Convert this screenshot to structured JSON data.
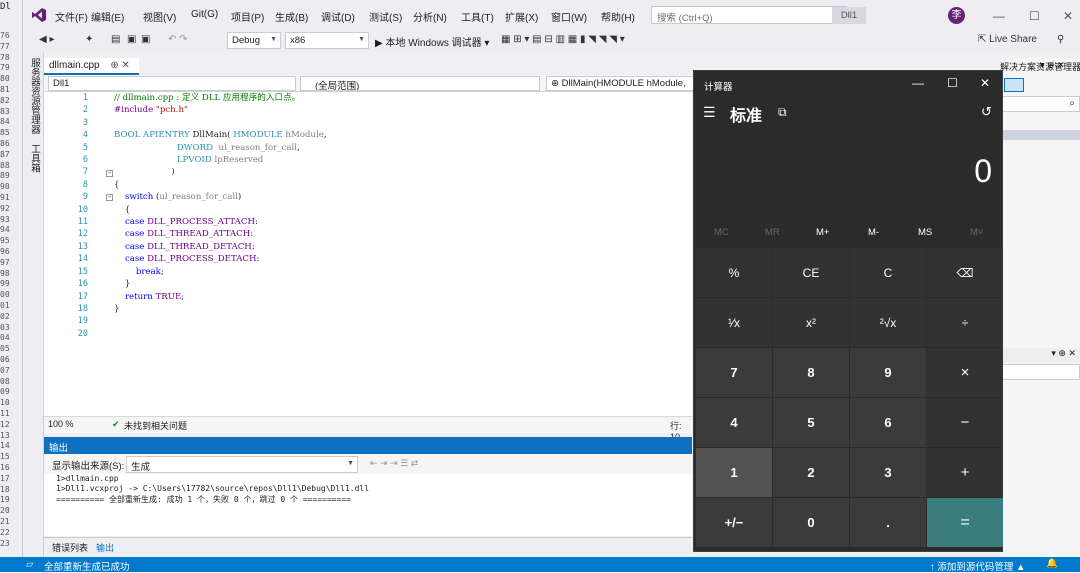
{
  "window_title_prefix": "Dl",
  "menu": [
    "文件(F)",
    "编辑(E)",
    "视图(V)",
    "Git(G)",
    "项目(P)",
    "生成(B)",
    "调试(D)",
    "测试(S)",
    "分析(N)",
    "工具(T)",
    "扩展(X)",
    "窗口(W)",
    "帮助(H)"
  ],
  "search": {
    "placeholder": "搜索 (Ctrl+Q)"
  },
  "project_badge": "Dll1",
  "avatar_letter": "李",
  "toolbar": {
    "config": "Debug",
    "platform": "x86",
    "run_label": "▶ 本地 Windows 调试器 ▾",
    "live_share": "Live Share"
  },
  "side_tabs": [
    "服务器资源管理器",
    "工具箱"
  ],
  "doc_tab": {
    "name": "dllmain.cpp",
    "pin": "⊕ ✕"
  },
  "nav": {
    "project": "Dll1",
    "scope": "(全局范围)",
    "member": "DllMain(HMODULE hModule,"
  },
  "line_numbers": [
    "1",
    "2",
    "3",
    "4",
    "5",
    "6",
    "7",
    "8",
    "9",
    "10",
    "11",
    "12",
    "13",
    "14",
    "15",
    "16",
    "17",
    "18",
    "19",
    "20"
  ],
  "left_numbers": [
    "76",
    "77",
    "78",
    "79",
    "80",
    "81",
    "82",
    "83",
    "84",
    "85",
    "86",
    "87",
    "88",
    "89",
    "90",
    "91",
    "92",
    "93",
    "94",
    "95",
    "96",
    "97",
    "98",
    "99",
    "00",
    "01",
    "02",
    "03",
    "04",
    "05",
    "06",
    "07",
    "08",
    "09",
    "10",
    "11",
    "12",
    "13",
    "14",
    "15",
    "16",
    "17",
    "18",
    "19",
    "20",
    "21",
    "22",
    "23"
  ],
  "status_strip": {
    "zoom": "100 %",
    "issues": "未找到相关问题",
    "line": "行: 10"
  },
  "output": {
    "title": "输出",
    "source_label": "显示输出来源(S):",
    "source_value": "生成",
    "lines": [
      "1>dllmain.cpp",
      "1>Dll1.vcxproj -> C:\\Users\\17782\\source\\repos\\Dll1\\Debug\\Dll1.dll",
      "========== 全部重新生成: 成功 1 个，失败 0 个，跳过 0 个 =========="
    ]
  },
  "bottom_tabs": [
    "错误列表",
    "输出"
  ],
  "statusbar": {
    "left": "全部重新生成已成功",
    "right": "↑ 添加到源代码管理 ▲"
  },
  "right_panel": {
    "title": "解决方案资源管理器"
  },
  "calculator": {
    "title": "计算器",
    "mode": "标准",
    "display": "0",
    "memory": [
      "MC",
      "MR",
      "M+",
      "M-",
      "MS",
      "M˅"
    ],
    "keys": [
      [
        "%",
        "CE",
        "C",
        "⌫"
      ],
      [
        "¹⁄x",
        "x²",
        "²√x",
        "÷"
      ],
      [
        "7",
        "8",
        "9",
        "×"
      ],
      [
        "4",
        "5",
        "6",
        "−"
      ],
      [
        "1",
        "2",
        "3",
        "+"
      ],
      [
        "+/−",
        "0",
        ".",
        "="
      ]
    ]
  }
}
